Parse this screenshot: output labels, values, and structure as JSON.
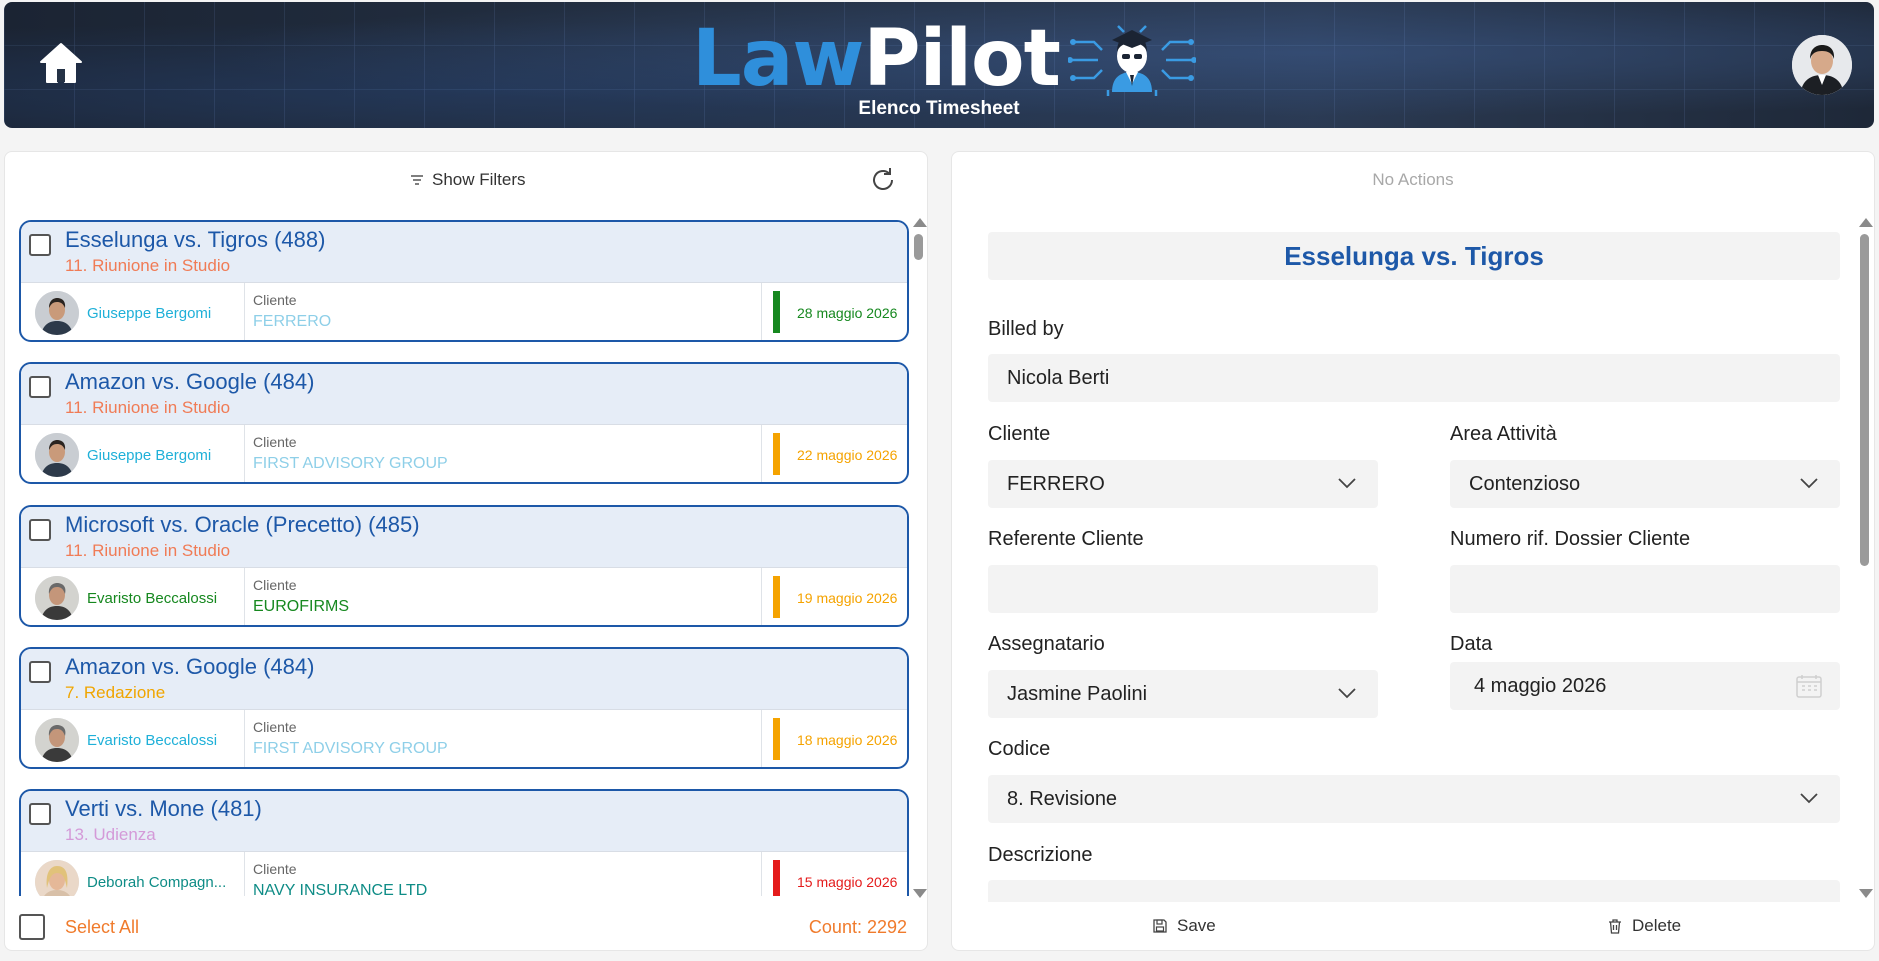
{
  "header": {
    "logo_part1": "Law",
    "logo_part2": "Pilot",
    "subtitle": "Elenco Timesheet",
    "icons": {
      "home": "home-icon",
      "user": "user-avatar"
    }
  },
  "list": {
    "show_filters_label": "Show Filters",
    "cliente_label": "Cliente",
    "items": [
      {
        "title": "Esselunga vs. Tigros (488)",
        "subtitle": "11. Riunione in Studio",
        "subtitle_color": "#f07b55",
        "person": "Giuseppe Bergomi",
        "person_color": "#1fb0d8",
        "cliente": "FERRERO",
        "cliente_color": "#8ecfe8",
        "date": "28 maggio 2026",
        "status_color": "#16881f"
      },
      {
        "title": "Amazon vs. Google (484)",
        "subtitle": "11. Riunione in Studio",
        "subtitle_color": "#f07b55",
        "person": "Giuseppe Bergomi",
        "person_color": "#1fb0d8",
        "cliente": "FIRST ADVISORY GROUP",
        "cliente_color": "#8ecfe8",
        "date": "22 maggio 2026",
        "status_color": "#f5a300"
      },
      {
        "title": "Microsoft vs. Oracle (Precetto) (485)",
        "subtitle": "11. Riunione in Studio",
        "subtitle_color": "#f07b55",
        "person": "Evaristo Beccalossi",
        "person_color": "#16881f",
        "cliente": "EUROFIRMS",
        "cliente_color": "#16881f",
        "date": "19 maggio 2026",
        "status_color": "#f5a300"
      },
      {
        "title": "Amazon vs. Google (484)",
        "subtitle": "7. Redazione",
        "subtitle_color": "#f0a500",
        "person": "Evaristo Beccalossi",
        "person_color": "#1fb0d8",
        "cliente": "FIRST ADVISORY GROUP",
        "cliente_color": "#8ecfe8",
        "date": "18 maggio 2026",
        "status_color": "#f5a300"
      },
      {
        "title": "Verti vs. Mone (481)",
        "subtitle": "13. Udienza",
        "subtitle_color": "#d49ad8",
        "person": "Deborah Compagn...",
        "person_color": "#0e8c86",
        "cliente": "NAVY INSURANCE LTD",
        "cliente_color": "#0e8c86",
        "date": "15 maggio 2026",
        "status_color": "#e41b1b"
      }
    ],
    "select_all_label": "Select All",
    "count_label": "Count: 2292"
  },
  "detail": {
    "no_actions": "No Actions",
    "title": "Esselunga vs. Tigros",
    "billed_by_label": "Billed by",
    "billed_by_value": "Nicola Berti",
    "cliente_label": "Cliente",
    "cliente_value": "FERRERO",
    "area_label": "Area Attività",
    "area_value": "Contenzioso",
    "referente_label": "Referente Cliente",
    "referente_value": "",
    "numero_label": "Numero rif. Dossier Cliente",
    "numero_value": "",
    "assegnatario_label": "Assegnatario",
    "assegnatario_value": "Jasmine Paolini",
    "data_label": "Data",
    "data_value": "4 maggio 2026",
    "codice_label": "Codice",
    "codice_value": "8. Revisione",
    "descrizione_label": "Descrizione",
    "save_label": "Save",
    "delete_label": "Delete"
  },
  "colors": {
    "accent_blue": "#1d58a8",
    "orange": "#f07b2c"
  }
}
